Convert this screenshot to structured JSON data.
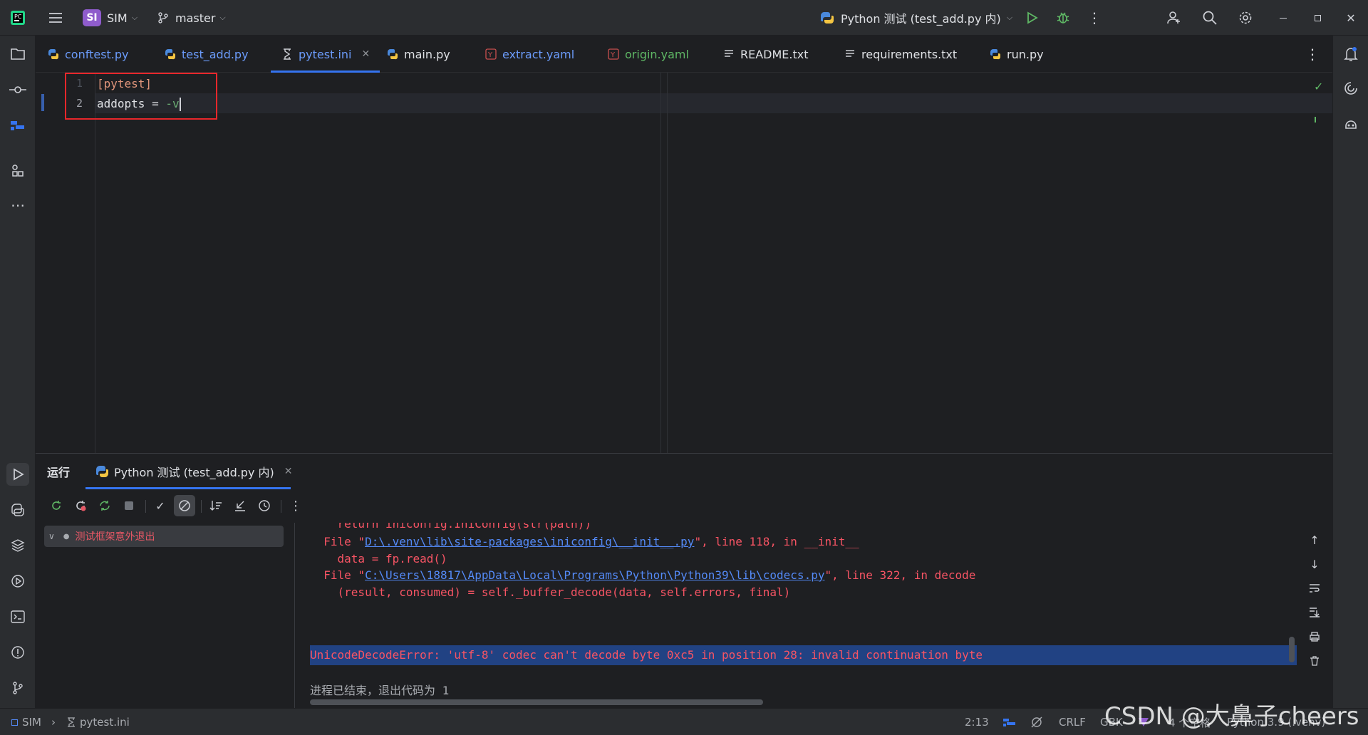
{
  "titlebar": {
    "project_badge": "SI",
    "project_name": "SIM",
    "branch": "master",
    "run_config": "Python 测试 (test_add.py 内)"
  },
  "tabs": [
    {
      "label": "conftest.py",
      "color": "#6b9bfa",
      "icon": "python-icon"
    },
    {
      "label": "test_add.py",
      "color": "#6b9bfa",
      "icon": "python-icon"
    },
    {
      "label": "pytest.ini",
      "color": "#6b9bfa",
      "icon": "ini-icon",
      "active": true
    },
    {
      "label": "main.py",
      "color": "#dfe1e5",
      "icon": "python-icon"
    },
    {
      "label": "extract.yaml",
      "color": "#6b9bfa",
      "icon": "yaml-icon"
    },
    {
      "label": "origin.yaml",
      "color": "#5fb865",
      "icon": "yaml-icon"
    },
    {
      "label": "README.txt",
      "color": "#dfe1e5",
      "icon": "text-icon"
    },
    {
      "label": "requirements.txt",
      "color": "#dfe1e5",
      "icon": "text-icon"
    },
    {
      "label": "run.py",
      "color": "#dfe1e5",
      "icon": "python-icon"
    }
  ],
  "editor": {
    "line_numbers": [
      "1",
      "2"
    ],
    "line1": "[pytest]",
    "line2_key": "addopts = ",
    "line2_value": "-v"
  },
  "run_panel": {
    "tab_run": "运行",
    "tab_config": "Python 测试 (test_add.py 内)",
    "tree_item": "测试框架意外退出"
  },
  "console": {
    "clipped_line": "    return iniconfig.IniConfig(str(path))",
    "file1_prefix": "  File \"",
    "file1_link": "D:\\.venv\\lib\\site-packages\\iniconfig\\__init__.py",
    "file1_suffix": "\", line 118, in __init__",
    "code1": "    data = fp.read()",
    "file2_prefix": "  File \"",
    "file2_link": "C:\\Users\\18817\\AppData\\Local\\Programs\\Python\\Python39\\lib\\codecs.py",
    "file2_suffix": "\", line 322, in decode",
    "code2": "    (result, consumed) = self._buffer_decode(data, self.errors, final)",
    "error": "UnicodeDecodeError: 'utf-8' codec can't decode byte 0xc5 in position 28: invalid continuation byte",
    "exit": "进程已结束，退出代码为 1"
  },
  "statusbar": {
    "project": "SIM",
    "file": "pytest.ini",
    "position": "2:13",
    "line_sep": "CRLF",
    "encoding": "GBK",
    "indent": "4 个空格",
    "interpreter": "Python 3.9 (.venv)"
  },
  "watermark": "CSDN @大鼻子cheers"
}
